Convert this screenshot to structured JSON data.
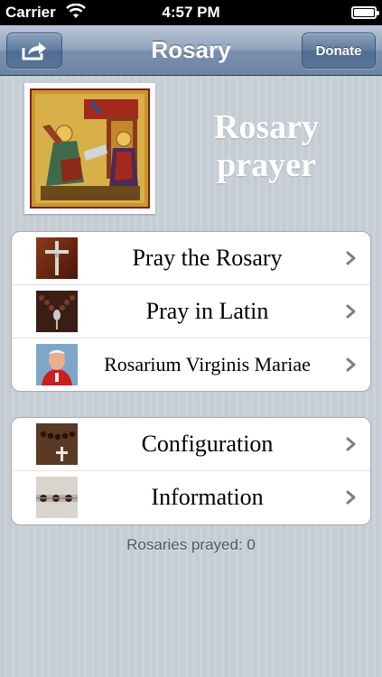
{
  "status_bar": {
    "carrier": "Carrier",
    "time": "4:57 PM",
    "wifi_icon": "wifi-icon",
    "battery_icon": "battery-icon"
  },
  "nav": {
    "title": "Rosary",
    "share_icon": "share-icon",
    "donate_label": "Donate"
  },
  "header": {
    "image": "annunciation-icon-painting",
    "title": "Rosary prayer"
  },
  "menu_primary": [
    {
      "label": "Pray the Rosary",
      "thumb": "crucifix-thumb"
    },
    {
      "label": "Pray in Latin",
      "thumb": "rosary-beads-thumb"
    },
    {
      "label": "Rosarium Virginis Mariae",
      "thumb": "pope-portrait-thumb"
    }
  ],
  "menu_secondary": [
    {
      "label": "Configuration",
      "thumb": "rosary-cross-thumb"
    },
    {
      "label": "Information",
      "thumb": "beads-closeup-thumb"
    }
  ],
  "footer": {
    "prayed_count": "Rosaries prayed: 0"
  },
  "colors": {
    "background": "#c5ccd4",
    "navbar": "#7a91ae",
    "footer_text": "#4c566c"
  }
}
